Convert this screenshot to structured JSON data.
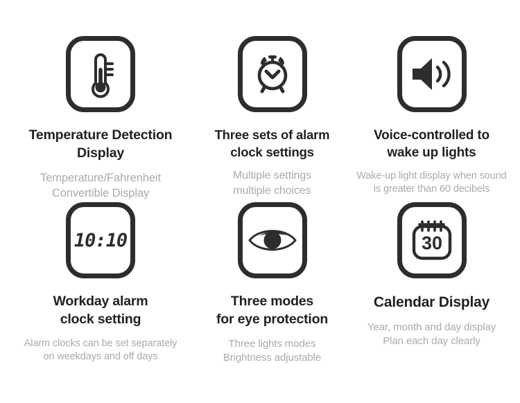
{
  "page": {
    "background": "#ffffff",
    "title_color": "#231f20",
    "subtitle_color": "#aaaaaa",
    "icon_stroke_color": "#2d2d2d"
  },
  "features": [
    {
      "icon": "thermometer-icon",
      "title": "Temperature Detection\nDisplay",
      "subtitle": "Temperature/Fahrenheit\nConvertible Display"
    },
    {
      "icon": "alarm-clock-icon",
      "title": "Three sets of alarm\nclock settings",
      "subtitle": "Multiple settings\nmultiple choices"
    },
    {
      "icon": "speaker-volume-icon",
      "title": "Voice-controlled to\nwake up lights",
      "subtitle": "Wake-up light display when sound\nis greater than 60 decibels"
    },
    {
      "icon": "digital-clock-icon",
      "icon_text": "10:10",
      "title": "Workday alarm\nclock setting",
      "subtitle": "Alarm clocks can be set separately\non weekdays and off days"
    },
    {
      "icon": "eye-icon",
      "title": "Three modes\nfor eye protection",
      "subtitle": "Three lights modes\nBrightness adjustable"
    },
    {
      "icon": "calendar-icon",
      "icon_text": "30",
      "title": "Calendar Display",
      "subtitle": "Year, month and day display\nPlan each day clearly"
    }
  ]
}
